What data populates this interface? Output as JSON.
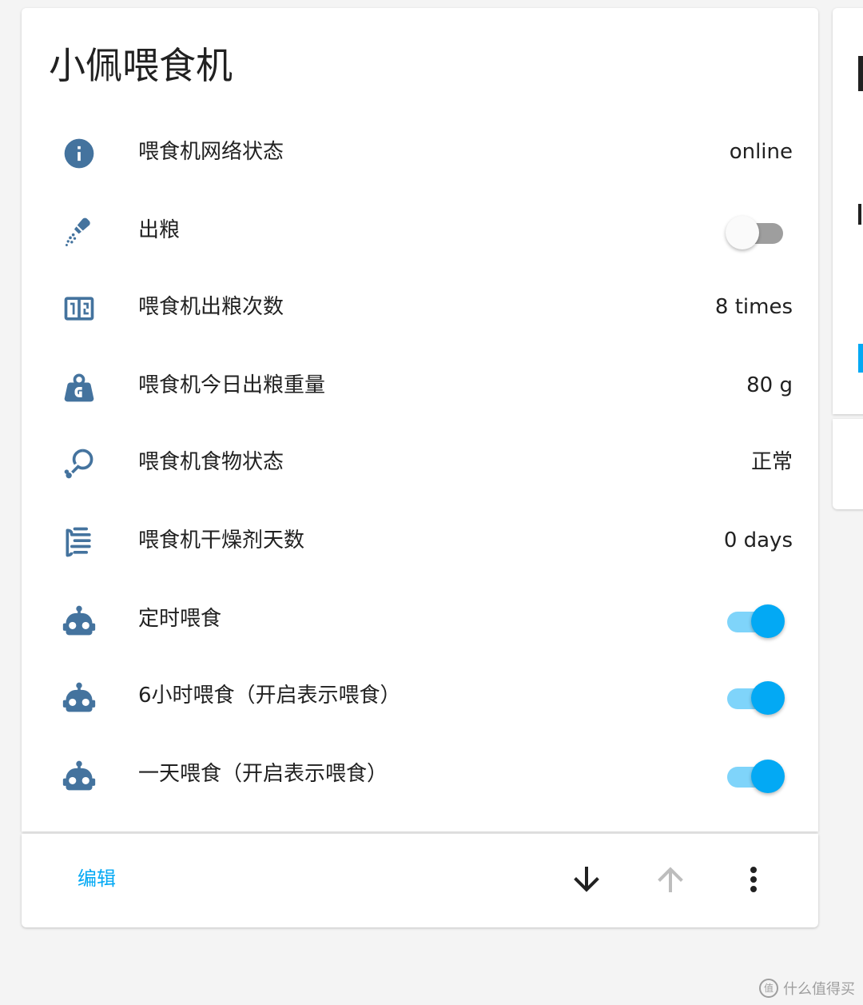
{
  "card": {
    "title": "小佩喂食机",
    "rows": [
      {
        "icon": "info-icon",
        "label": "喂食机网络状态",
        "value": "online"
      },
      {
        "icon": "feeder-scoop-icon",
        "label": "出粮",
        "toggle": "off"
      },
      {
        "icon": "counter-icon",
        "label": "喂食机出粮次数",
        "value": "8 times"
      },
      {
        "icon": "weight-icon",
        "label": "喂食机今日出粮重量",
        "value": "80 g"
      },
      {
        "icon": "food-drumstick-icon",
        "label": "喂食机食物状态",
        "value": "正常"
      },
      {
        "icon": "desiccant-icon",
        "label": "喂食机干燥剂天数",
        "value": "0 days"
      },
      {
        "icon": "robot-icon",
        "label": "定时喂食",
        "toggle": "on"
      },
      {
        "icon": "robot-icon",
        "label": "6小时喂食（开启表示喂食）",
        "toggle": "on"
      },
      {
        "icon": "robot-icon",
        "label": "一天喂食（开启表示喂食）",
        "toggle": "on"
      }
    ]
  },
  "footer": {
    "edit_label": "编辑",
    "move_down_icon": "arrow-down-icon",
    "move_up_icon": "arrow-up-icon",
    "menu_icon": "dots-vertical-icon"
  },
  "watermark": {
    "logo": "值",
    "text": "什么值得买"
  },
  "colors": {
    "icon": "#44739e",
    "accent": "#03a9f4",
    "toggle_on_track": "#7fd4fa",
    "toggle_off_track": "#9e9e9e",
    "disabled": "#bdbdbd",
    "text": "#212121"
  }
}
